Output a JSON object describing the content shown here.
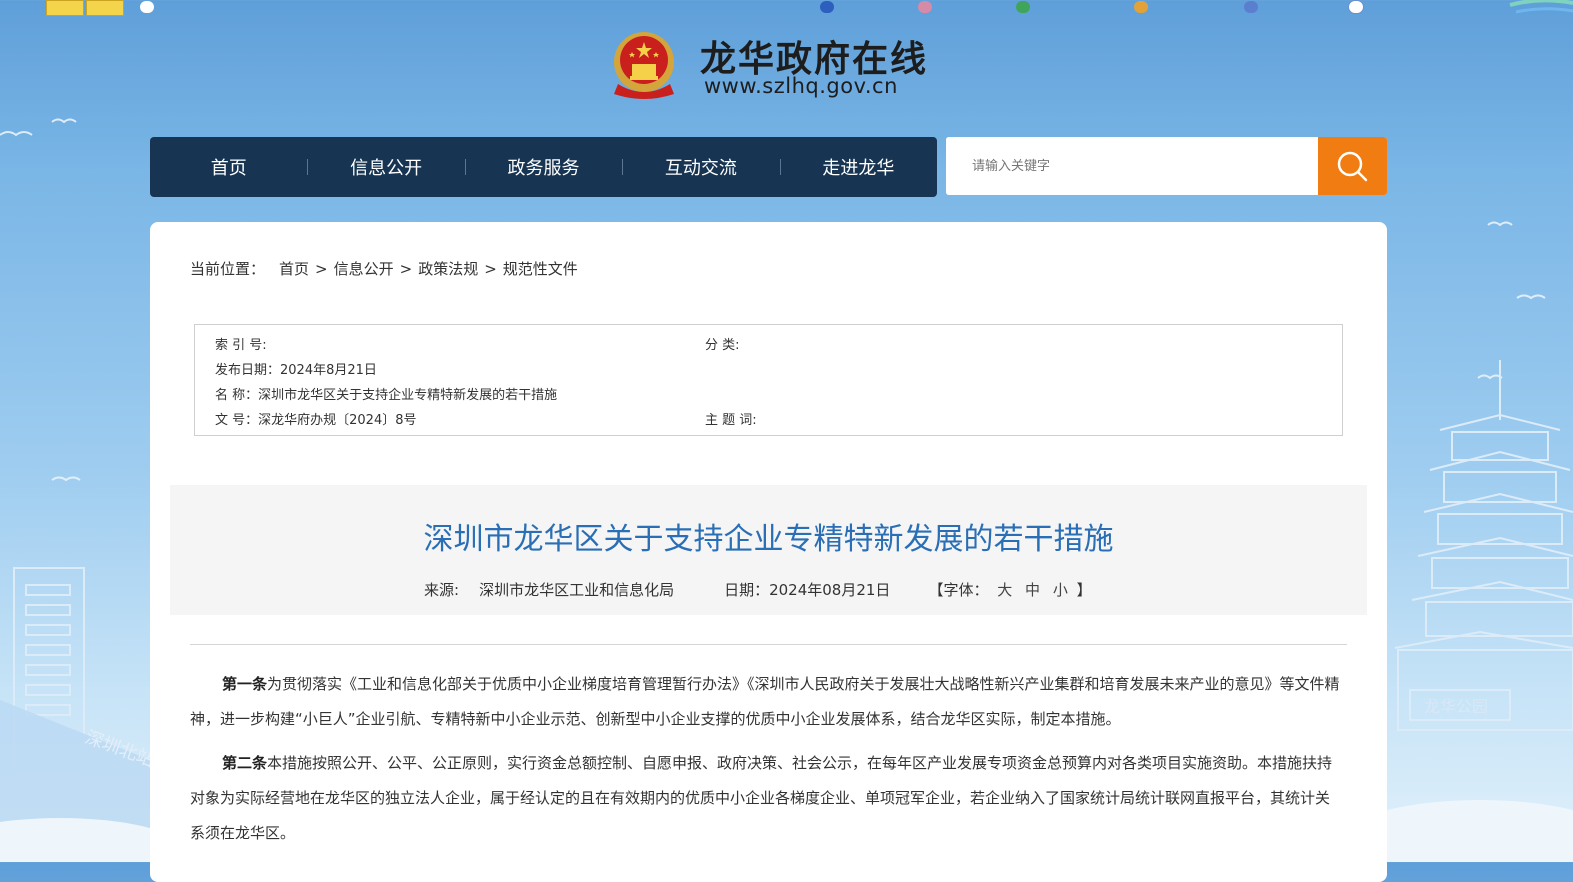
{
  "colors": {
    "nav_bg": "#173553",
    "search_button": "#f07c12",
    "title_blue": "#2a6fb6",
    "accent_red": "#c9201e"
  },
  "site": {
    "title": "龙华政府在线",
    "url": "www.szlhq.gov.cn"
  },
  "nav": {
    "items": [
      "首页",
      "信息公开",
      "政务服务",
      "互动交流",
      "走进龙华"
    ]
  },
  "search": {
    "placeholder": "请输入关键字",
    "icon": "search-icon"
  },
  "breadcrumb": {
    "label": "当前位置：",
    "items": [
      "首页",
      "信息公开",
      "政策法规",
      "规范性文件"
    ],
    "separator": ">"
  },
  "info": {
    "index_label": "索 引 号:",
    "category_label": "分 类:",
    "publish_date": "发布日期：2024年8月21日",
    "name": "名 称：深圳市龙华区关于支持企业专精特新发展的若干措施",
    "doc_number": "文 号：深龙华府办规〔2024〕8号",
    "keywords_label": "主 题 词:"
  },
  "article": {
    "title": "深圳市龙华区关于支持企业专精特新发展的若干措施",
    "source_label": "来源:",
    "source": "深圳市龙华区工业和信息化局",
    "date": "日期：2024年08月21日",
    "fontsize_prefix": "【字体：",
    "fontsize_options": [
      "大",
      "中",
      "小"
    ],
    "fontsize_suffix": "】",
    "paragraphs": [
      {
        "lead": "第一条",
        "text": "为贯彻落实《工业和信息化部关于优质中小企业梯度培育管理暂行办法》《深圳市人民政府关于发展壮大战略性新兴产业集群和培育发展未来产业的意见》等文件精神，进一步构建“小巨人”企业引航、专精特新中小企业示范、创新型中小企业支撑的优质中小企业发展体系，结合龙华区实际，制定本措施。"
      },
      {
        "lead": "第二条",
        "text": "本措施按照公开、公平、公正原则，实行资金总额控制、自愿申报、政府决策、社会公示，在每年区产业发展专项资金总预算内对各类项目实施资助。本措施扶持对象为实际经营地在龙华区的独立法人企业，属于经认定的且在有效期内的优质中小企业各梯度企业、单项冠军企业，若企业纳入了国家统计局统计联网直报平台，其统计关系须在龙华区。"
      }
    ]
  },
  "backdrop": {
    "city_sign": "深圳北站",
    "park_sign": "龙华公园"
  }
}
